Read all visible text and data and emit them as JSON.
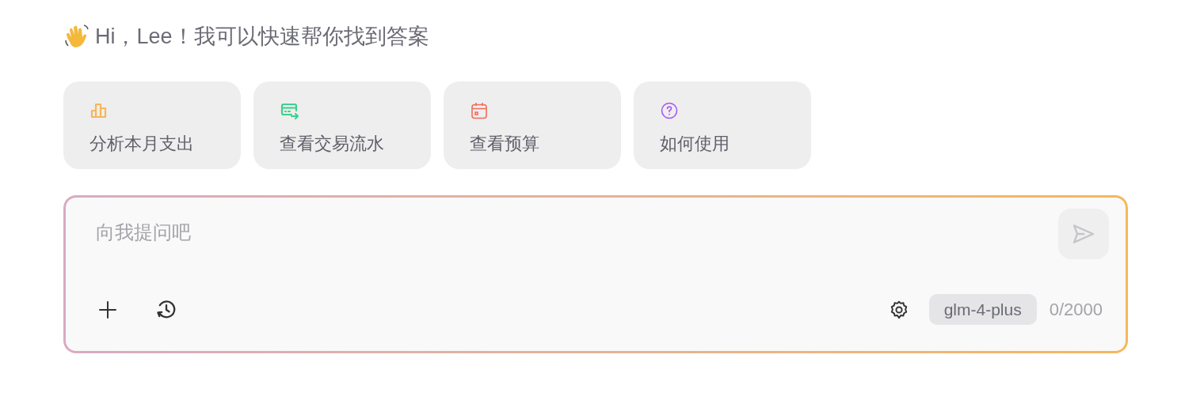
{
  "greeting": "Hi，Lee！我可以快速帮你找到答案",
  "suggestions": [
    {
      "kind": "chart",
      "color": "#f5b65a",
      "label": "分析本月支出"
    },
    {
      "kind": "card",
      "color": "#3ecf8e",
      "label": "查看交易流水"
    },
    {
      "kind": "calendar",
      "color": "#f06b5b",
      "label": "查看预算"
    },
    {
      "kind": "help",
      "color": "#a855f7",
      "label": "如何使用"
    }
  ],
  "composer": {
    "placeholder": "向我提问吧",
    "model": "glm-4-plus",
    "count": "0/2000"
  }
}
